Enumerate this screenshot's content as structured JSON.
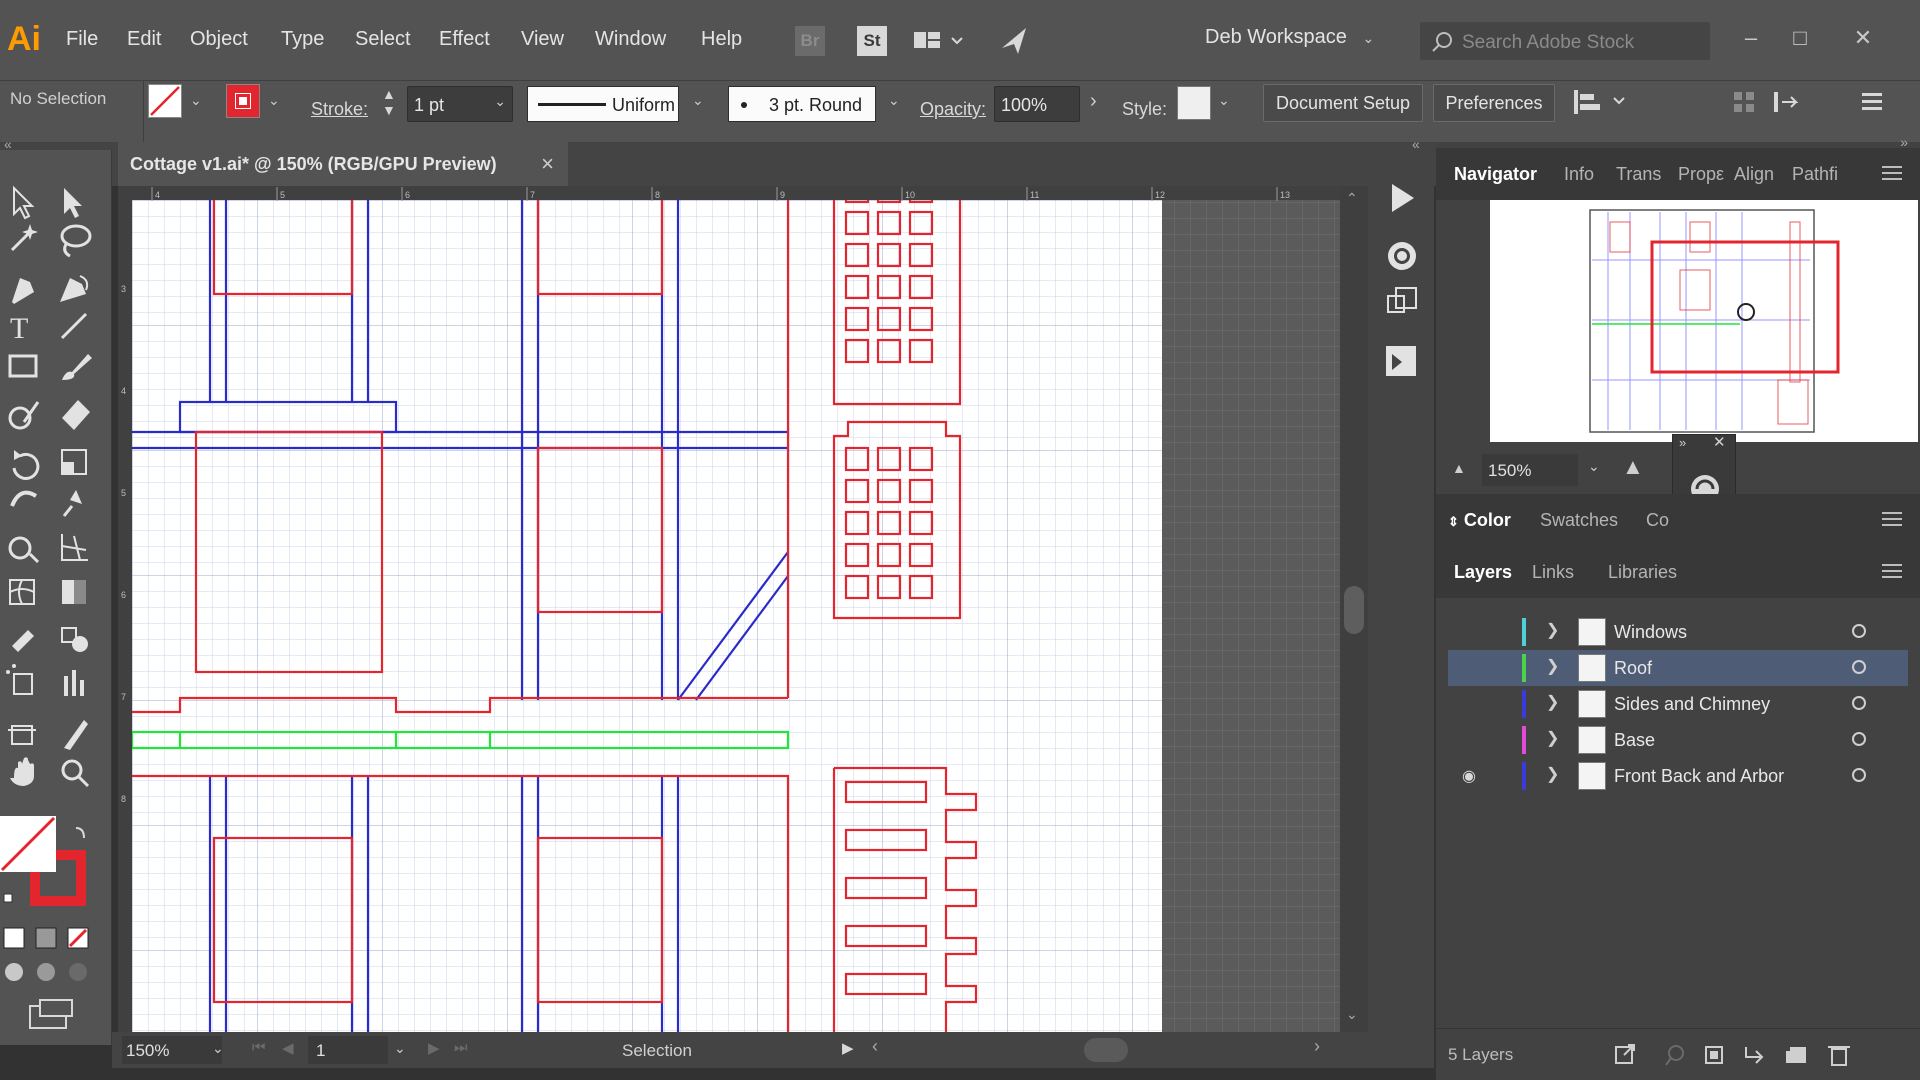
{
  "app": {
    "logo": "Ai",
    "menu": [
      "File",
      "Edit",
      "Object",
      "Type",
      "Select",
      "Effect",
      "View",
      "Window",
      "Help"
    ],
    "bridge_label": "Br",
    "stock_label": "St",
    "workspace": "Deb Workspace",
    "search_placeholder": "Search Adobe Stock"
  },
  "control_bar": {
    "selection_status": "No Selection",
    "stroke_label": "Stroke:",
    "stroke_weight": "1 pt",
    "profile": "Uniform",
    "brush": "3 pt. Round",
    "opacity_label": "Opacity:",
    "opacity_value": "100%",
    "style_label": "Style:",
    "document_setup": "Document Setup",
    "preferences": "Preferences"
  },
  "document": {
    "tab_title": "Cottage v1.ai* @ 150% (RGB/GPU Preview)",
    "close": "×",
    "ruler_labels": [
      "4",
      "5",
      "6",
      "7",
      "8",
      "9",
      "10",
      "11",
      "12",
      "13"
    ],
    "left_ruler_labels": [
      "3",
      "4",
      "5",
      "6",
      "7",
      "8"
    ]
  },
  "status_bar": {
    "zoom": "150%",
    "artboard": "1",
    "tool_name": "Selection"
  },
  "navigator": {
    "tabs": [
      "Navigator",
      "Info",
      "Trans",
      "Propε",
      "Align",
      "Pathfi"
    ],
    "zoom": "150%"
  },
  "color_panel": {
    "tabs": [
      "Color",
      "Swatches",
      "Co"
    ]
  },
  "layers_panel": {
    "tabs": [
      "Layers",
      "Links",
      "Libraries"
    ],
    "layers": [
      {
        "name": "Windows",
        "color": "#4fd0d6",
        "visible": false,
        "selected": false
      },
      {
        "name": "Roof",
        "color": "#4bd44b",
        "visible": false,
        "selected": true
      },
      {
        "name": "Sides and Chimney",
        "color": "#3b3bdc",
        "visible": false,
        "selected": false
      },
      {
        "name": "Base",
        "color": "#e24ad9",
        "visible": false,
        "selected": false
      },
      {
        "name": "Front Back and Arbor",
        "color": "#3b3bdc",
        "visible": true,
        "selected": false
      }
    ],
    "count": "5 Layers"
  },
  "colors": {
    "red": "#e3262e",
    "blue": "#2b2bc8",
    "green": "#22e53a",
    "grid": "#c8d4ec"
  }
}
